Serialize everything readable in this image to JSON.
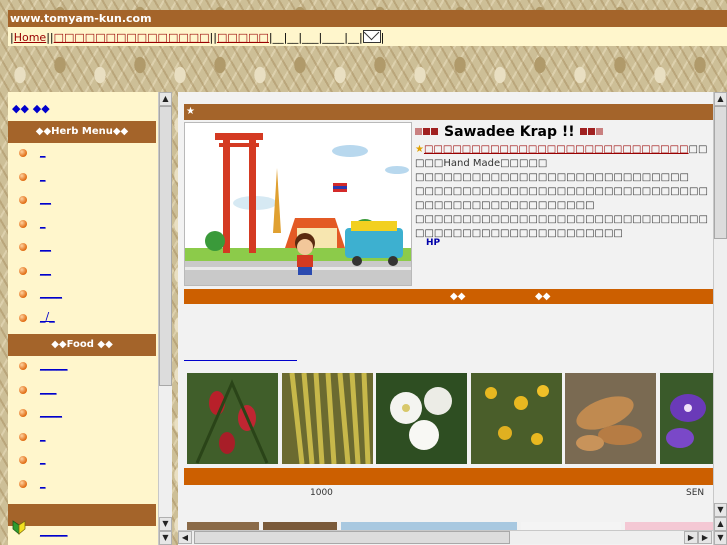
{
  "header": {
    "site_url": "www.tomyam-kun.com"
  },
  "nav": {
    "prefix": "|",
    "home": "Home",
    "sep1": "||",
    "item2": "□□□□□□□□□□□□□□□",
    "sep2": "||",
    "item3": "□□□□□",
    "tail": "|__|__|___|____|__|",
    "end": "|"
  },
  "sidebar": {
    "top_link": "◆◆     ◆◆",
    "herb_menu_title": "◆◆Herb Menu◆◆",
    "herb_items": [
      "_",
      "_",
      "__",
      "_",
      "__",
      "__",
      "____",
      "_/_"
    ],
    "food_title": "◆◆Food     ◆◆",
    "food_items": [
      "_____",
      "___",
      "____",
      "_",
      "_",
      "_"
    ],
    "bottom_link": "_____"
  },
  "main": {
    "star": "★",
    "welcome_title": "Sawadee Krap !!",
    "welcome_red": "□□□□□□□□□□□□□□□□□□□□□□□□□□□□",
    "welcome_after": "□□□□□Hand Made□□□□□",
    "welcome_lines": [
      "□□□□□□□□□□□□□□□□□□□□□□□□□□□□□",
      "□□□□□□□□□□□□□□□□□□□□□□□□□□□□□□□□□□□□□□□□□□□□□□□□□□",
      "□□□□□□□□□□□□□□□□□□□□□□□□□□□□□□□□□□□□□□□□□□□□□□□□□□□□□"
    ],
    "hp_link": "HP",
    "section_bar": "◆◆                    ◆◆",
    "caption_left": "1000",
    "caption_right": "SEN"
  },
  "colors": {
    "brown": "#a4642a",
    "orange": "#cc5f00",
    "cream": "#fff6cc"
  }
}
